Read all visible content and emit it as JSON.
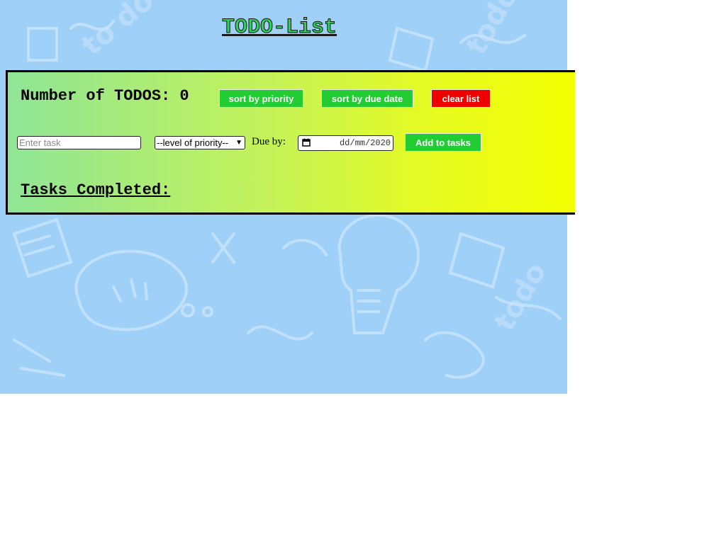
{
  "title": "TODO-List",
  "todo_count": {
    "label": "Number of TODOS: 0"
  },
  "buttons": {
    "sort_priority": "sort by priority",
    "sort_due": "sort by due date",
    "clear": "clear list",
    "add": "Add to tasks"
  },
  "form": {
    "task_placeholder": "Enter task",
    "priority_selected": "--level of priority--",
    "due_label": "Due by:",
    "date_placeholder": "dd/mm/2020"
  },
  "completed": {
    "heading": "Tasks Completed:"
  },
  "colors": {
    "background": "#9fd0f8",
    "title_green": "#2fd15a",
    "button_green": "#22cc33",
    "button_red": "#ee0000",
    "panel_gradient_start": "#8fe596",
    "panel_gradient_end": "#f2ff00"
  },
  "icons": [
    "calendar-icon",
    "chevron-down-icon"
  ]
}
